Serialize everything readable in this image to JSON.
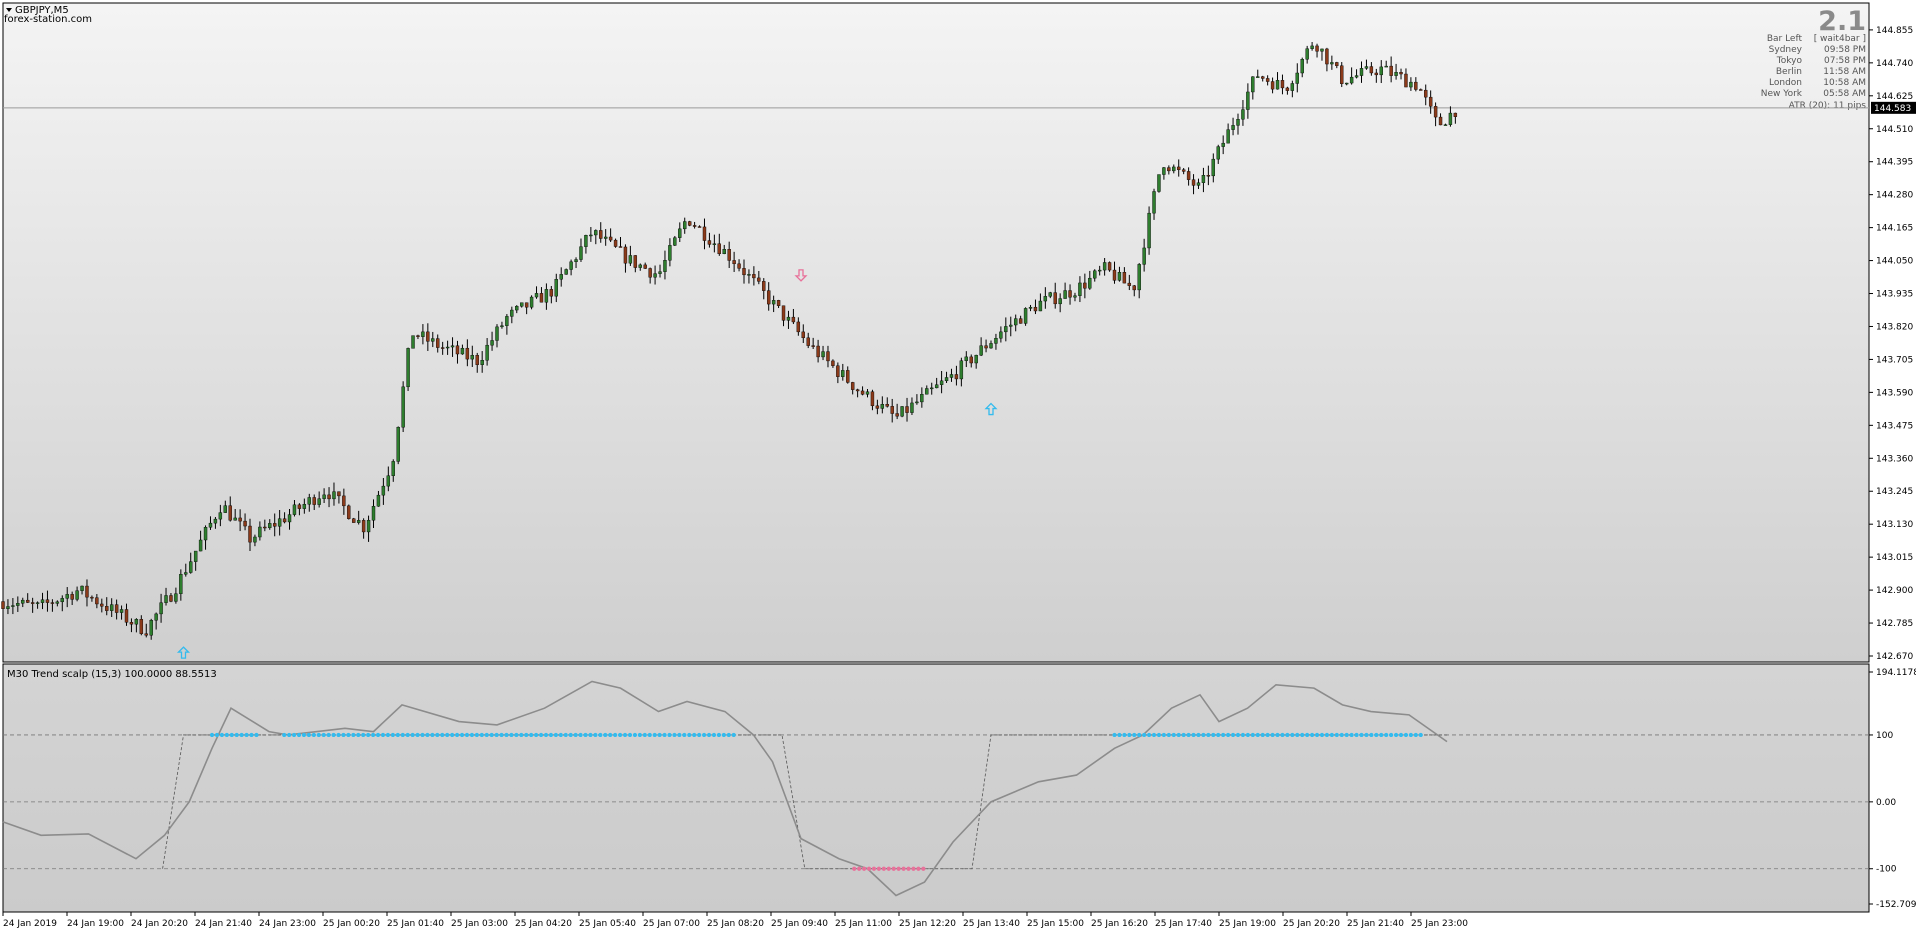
{
  "symbol_title": "GBPJPY,M5",
  "watermark": "forex-station.com",
  "spread_value": "2.1",
  "session_info": [
    {
      "label": "Bar Left",
      "value": "[ wait4bar ]"
    },
    {
      "label": "Sydney",
      "value": "09:58 PM"
    },
    {
      "label": "Tokyo",
      "value": "07:58 PM"
    },
    {
      "label": "Berlin",
      "value": "11:58 AM"
    },
    {
      "label": "London",
      "value": "10:58 AM"
    },
    {
      "label": "New York",
      "value": "05:58 AM"
    }
  ],
  "atr_text": "ATR (20): 11 pips",
  "current_price": "144.583",
  "price_axis": [
    "144.855",
    "144.740",
    "144.625",
    "144.510",
    "144.395",
    "144.280",
    "144.165",
    "144.050",
    "143.935",
    "143.820",
    "143.705",
    "143.590",
    "143.475",
    "143.360",
    "143.245",
    "143.130",
    "143.015",
    "142.900",
    "142.785",
    "142.670"
  ],
  "time_axis": [
    "24 Jan 2019",
    "24 Jan 19:00",
    "24 Jan 20:20",
    "24 Jan 21:40",
    "24 Jan 23:00",
    "25 Jan 00:20",
    "25 Jan 01:40",
    "25 Jan 03:00",
    "25 Jan 04:20",
    "25 Jan 05:40",
    "25 Jan 07:00",
    "25 Jan 08:20",
    "25 Jan 09:40",
    "25 Jan 11:00",
    "25 Jan 12:20",
    "25 Jan 13:40",
    "25 Jan 15:00",
    "25 Jan 16:20",
    "25 Jan 17:40",
    "25 Jan 19:00",
    "25 Jan 20:20",
    "25 Jan 21:40",
    "25 Jan 23:00"
  ],
  "indicator": {
    "title": "M30 Trend scalp (15,3) 100.0000 88.5513",
    "axis": [
      "194.1178",
      "100",
      "0.00",
      "-100",
      "-152.7094"
    ]
  },
  "colors": {
    "bull_candle": "#2e7d2e",
    "bear_candle": "#8b3a1a",
    "up_signal": "#33bbee",
    "down_signal": "#e8719a",
    "indicator_line": "#8c8c8c"
  },
  "chart_data": {
    "type": "candlestick",
    "title": "GBPJPY,M5",
    "ylim": [
      142.67,
      144.9
    ],
    "price_path": [
      {
        "t": 0,
        "p": 142.86
      },
      {
        "t": 0.019,
        "p": 142.84
      },
      {
        "t": 0.04,
        "p": 142.9
      },
      {
        "t": 0.06,
        "p": 142.82
      },
      {
        "t": 0.075,
        "p": 142.76
      },
      {
        "t": 0.09,
        "p": 142.9
      },
      {
        "t": 0.115,
        "p": 143.2
      },
      {
        "t": 0.13,
        "p": 143.08
      },
      {
        "t": 0.15,
        "p": 143.16
      },
      {
        "t": 0.17,
        "p": 143.25
      },
      {
        "t": 0.19,
        "p": 143.12
      },
      {
        "t": 0.205,
        "p": 143.35
      },
      {
        "t": 0.215,
        "p": 143.8
      },
      {
        "t": 0.23,
        "p": 143.75
      },
      {
        "t": 0.25,
        "p": 143.7
      },
      {
        "t": 0.265,
        "p": 143.85
      },
      {
        "t": 0.29,
        "p": 143.95
      },
      {
        "t": 0.31,
        "p": 144.15
      },
      {
        "t": 0.33,
        "p": 144.05
      },
      {
        "t": 0.345,
        "p": 144.0
      },
      {
        "t": 0.36,
        "p": 144.2
      },
      {
        "t": 0.385,
        "p": 144.05
      },
      {
        "t": 0.405,
        "p": 143.9
      },
      {
        "t": 0.425,
        "p": 143.75
      },
      {
        "t": 0.45,
        "p": 143.6
      },
      {
        "t": 0.47,
        "p": 143.5
      },
      {
        "t": 0.5,
        "p": 143.65
      },
      {
        "t": 0.525,
        "p": 143.8
      },
      {
        "t": 0.545,
        "p": 143.9
      },
      {
        "t": 0.565,
        "p": 143.95
      },
      {
        "t": 0.58,
        "p": 144.02
      },
      {
        "t": 0.595,
        "p": 143.95
      },
      {
        "t": 0.61,
        "p": 144.4
      },
      {
        "t": 0.63,
        "p": 144.3
      },
      {
        "t": 0.645,
        "p": 144.5
      },
      {
        "t": 0.66,
        "p": 144.7
      },
      {
        "t": 0.675,
        "p": 144.65
      },
      {
        "t": 0.69,
        "p": 144.82
      },
      {
        "t": 0.705,
        "p": 144.68
      },
      {
        "t": 0.725,
        "p": 144.72
      },
      {
        "t": 0.745,
        "p": 144.66
      },
      {
        "t": 0.755,
        "p": 144.52
      },
      {
        "t": 0.765,
        "p": 144.58
      }
    ],
    "signals": [
      {
        "t": 0.095,
        "p": 142.68,
        "dir": "up"
      },
      {
        "t": 0.42,
        "p": 144.0,
        "dir": "down"
      },
      {
        "t": 0.52,
        "p": 143.53,
        "dir": "up"
      }
    ],
    "indicator_ylim": [
      -152.7094,
      194.1178
    ],
    "indicator_levels": [
      100,
      0,
      -100
    ],
    "indicator_line": [
      {
        "t": 0,
        "v": -30
      },
      {
        "t": 0.02,
        "v": -50
      },
      {
        "t": 0.045,
        "v": -48
      },
      {
        "t": 0.07,
        "v": -85
      },
      {
        "t": 0.085,
        "v": -50
      },
      {
        "t": 0.098,
        "v": 0
      },
      {
        "t": 0.11,
        "v": 80
      },
      {
        "t": 0.12,
        "v": 140
      },
      {
        "t": 0.14,
        "v": 105
      },
      {
        "t": 0.15,
        "v": 100
      },
      {
        "t": 0.18,
        "v": 110
      },
      {
        "t": 0.195,
        "v": 105
      },
      {
        "t": 0.21,
        "v": 145
      },
      {
        "t": 0.24,
        "v": 120
      },
      {
        "t": 0.26,
        "v": 115
      },
      {
        "t": 0.285,
        "v": 140
      },
      {
        "t": 0.31,
        "v": 180
      },
      {
        "t": 0.325,
        "v": 170
      },
      {
        "t": 0.345,
        "v": 135
      },
      {
        "t": 0.36,
        "v": 150
      },
      {
        "t": 0.38,
        "v": 135
      },
      {
        "t": 0.395,
        "v": 100
      },
      {
        "t": 0.405,
        "v": 60
      },
      {
        "t": 0.42,
        "v": -55
      },
      {
        "t": 0.44,
        "v": -85
      },
      {
        "t": 0.455,
        "v": -100
      },
      {
        "t": 0.47,
        "v": -140
      },
      {
        "t": 0.485,
        "v": -120
      },
      {
        "t": 0.5,
        "v": -60
      },
      {
        "t": 0.52,
        "v": 0
      },
      {
        "t": 0.545,
        "v": 30
      },
      {
        "t": 0.565,
        "v": 40
      },
      {
        "t": 0.585,
        "v": 80
      },
      {
        "t": 0.6,
        "v": 100
      },
      {
        "t": 0.615,
        "v": 140
      },
      {
        "t": 0.63,
        "v": 160
      },
      {
        "t": 0.64,
        "v": 120
      },
      {
        "t": 0.655,
        "v": 140
      },
      {
        "t": 0.67,
        "v": 175
      },
      {
        "t": 0.69,
        "v": 170
      },
      {
        "t": 0.705,
        "v": 145
      },
      {
        "t": 0.72,
        "v": 135
      },
      {
        "t": 0.74,
        "v": 130
      },
      {
        "t": 0.76,
        "v": 90
      }
    ],
    "indicator_step": [
      {
        "t": 0.084,
        "v": -100
      },
      {
        "t": 0.095,
        "v": 100
      },
      {
        "t": 0.41,
        "v": 100
      },
      {
        "t": 0.422,
        "v": -100
      },
      {
        "t": 0.51,
        "v": -100
      },
      {
        "t": 0.52,
        "v": 100
      },
      {
        "t": 0.76,
        "v": 100
      }
    ],
    "indicator_dots": [
      {
        "t0": 0.11,
        "t1": 0.135,
        "v": 100,
        "dir": "up"
      },
      {
        "t0": 0.148,
        "t1": 0.385,
        "v": 100,
        "dir": "up"
      },
      {
        "t0": 0.585,
        "t1": 0.748,
        "v": 100,
        "dir": "up"
      },
      {
        "t0": 0.448,
        "t1": 0.485,
        "v": -100,
        "dir": "down"
      }
    ]
  }
}
